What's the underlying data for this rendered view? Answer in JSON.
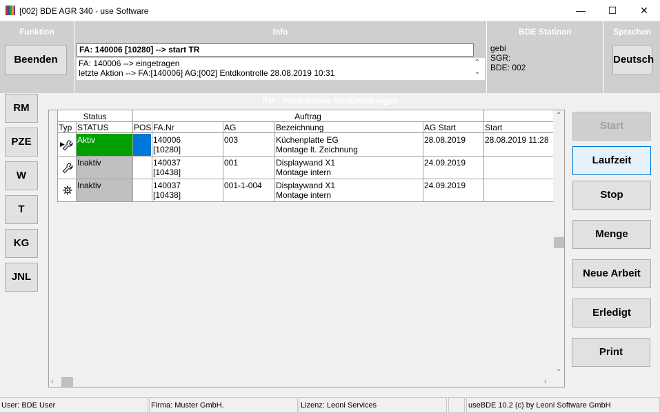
{
  "window": {
    "title": "[002] BDE AGR 340 - use Software",
    "minimize": "—",
    "maximize": "☐",
    "close": "✕"
  },
  "panels": {
    "funktion_label": "Funktion",
    "info_label": "Info",
    "station_label": "BDE Statinon",
    "sprachen_label": "Sprachen"
  },
  "buttons": {
    "beenden": "Beenden",
    "deutsch": "Deutsch"
  },
  "info": {
    "current": "FA: 140006 [10280] --> start TR",
    "log": [
      "FA: 140006 --> eingetragen",
      "letzte Aktion --> FA:[140006] AG:[002] Entdkontrolle 28.08.2019 10:31"
    ]
  },
  "station": {
    "lines": [
      "gebi",
      "SGR:",
      "BDE: 002"
    ]
  },
  "nav": [
    "RM",
    "PZE",
    "W",
    "T",
    "KG",
    "JNL"
  ],
  "section_title": "RM - Produktions Rückmeldungen",
  "table": {
    "group_headers": {
      "status": "Status",
      "auftrag": "Auftrag"
    },
    "columns": [
      "Typ",
      "STATUS",
      "POS",
      "FA.Nr",
      "AG",
      "Bezeichnung",
      "AG Start",
      "Start"
    ],
    "rows": [
      {
        "typ_icon": "wrench-icon",
        "status": "Aktiv",
        "status_color": "#00a000",
        "pos_color": "#0078d7",
        "fa_nr": "140006",
        "fa_sub": "[10280]",
        "ag": "003",
        "bez1": "Küchenplatte EG",
        "bez2": "Montage lt. Zeichnung",
        "ag_start": "28.08.2019",
        "start": "28.08.2019 11:28"
      },
      {
        "typ_icon": "wrench-icon",
        "status": "Inaktiv",
        "status_color": "#c0c0c0",
        "pos_color": "#ffffff",
        "fa_nr": "140037",
        "fa_sub": "[10438]",
        "ag": "001",
        "bez1": "Displaywand X1",
        "bez2": "Montage intern",
        "ag_start": "24.09.2019",
        "start": ""
      },
      {
        "typ_icon": "gear-icon",
        "status": "Inaktiv",
        "status_color": "#c0c0c0",
        "pos_color": "#ffffff",
        "fa_nr": "140037",
        "fa_sub": "[10438]",
        "ag": "001-1-004",
        "bez1": "Displaywand X1",
        "bez2": "Montage intern",
        "ag_start": "24.09.2019",
        "start": ""
      }
    ]
  },
  "actions": [
    "Start",
    "Laufzeit",
    "Stop",
    "Menge",
    "Neue Arbeit",
    "Erledigt",
    "Print"
  ],
  "statusbar": {
    "user": "User: BDE User",
    "firma": "Firma: Muster GmbH.",
    "lizenz": "Lizenz: Leoni Services",
    "empty": "",
    "version": "useBDE 10.2 (c) by Leoni Software GmbH"
  }
}
